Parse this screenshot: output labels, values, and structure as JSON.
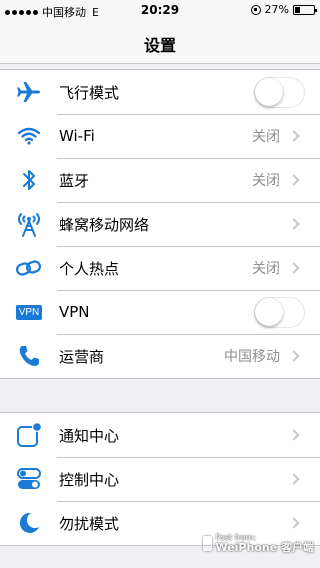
{
  "status_bar": {
    "carrier": "中国移动",
    "network": "E",
    "time": "20:29",
    "battery_percent": "27%",
    "battery_level": 0.27
  },
  "nav": {
    "title": "设置"
  },
  "colors": {
    "accent": "#1a7bd6",
    "secondary_text": "#8e8e93",
    "background": "#efeff4"
  },
  "group1": [
    {
      "label": "飞行模式",
      "icon": "airplane-icon",
      "type": "toggle",
      "on": false
    },
    {
      "label": "Wi-Fi",
      "icon": "wifi-icon",
      "type": "value",
      "value": "关闭"
    },
    {
      "label": "蓝牙",
      "icon": "bluetooth-icon",
      "type": "value",
      "value": "关闭"
    },
    {
      "label": "蜂窝移动网络",
      "icon": "cellular-antenna-icon",
      "type": "link"
    },
    {
      "label": "个人热点",
      "icon": "hotspot-icon",
      "type": "value",
      "value": "关闭"
    },
    {
      "label": "VPN",
      "icon": "vpn-icon",
      "icon_text": "VPN",
      "type": "toggle",
      "on": false
    },
    {
      "label": "运营商",
      "icon": "phone-icon",
      "type": "value",
      "value": "中国移动"
    }
  ],
  "group2": [
    {
      "label": "通知中心",
      "icon": "notification-center-icon",
      "type": "link"
    },
    {
      "label": "控制中心",
      "icon": "control-center-icon",
      "type": "link"
    },
    {
      "label": "勿扰模式",
      "icon": "moon-icon",
      "type": "link"
    }
  ],
  "watermark": {
    "line1": "Post from:",
    "line2": "WeiPhone 客户端"
  }
}
